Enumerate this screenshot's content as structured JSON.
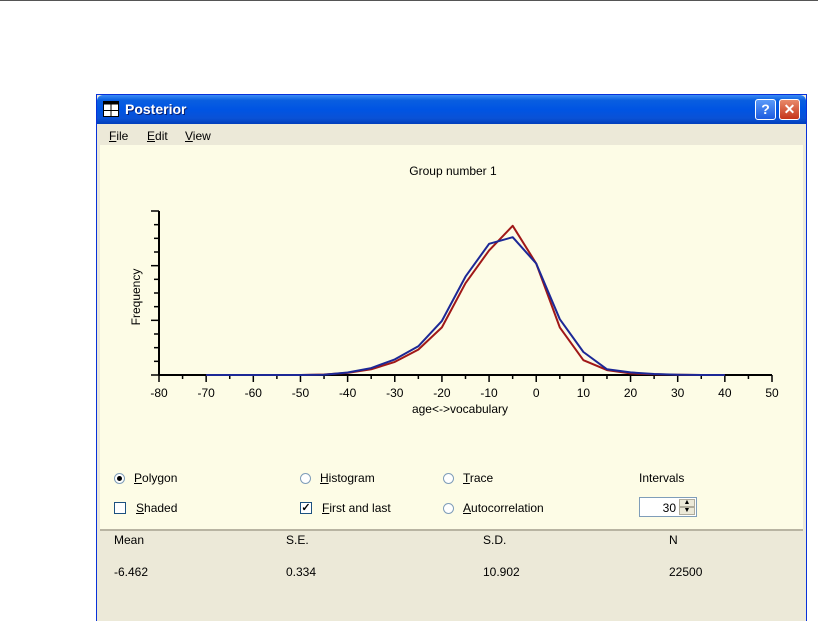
{
  "window": {
    "title": "Posterior"
  },
  "menu": [
    {
      "key": "F",
      "rest": "ile"
    },
    {
      "key": "E",
      "rest": "dit"
    },
    {
      "key": "V",
      "rest": "iew"
    }
  ],
  "chart_data": {
    "type": "line",
    "title": "Group number 1",
    "xlabel": "age<->vocabulary",
    "ylabel": "Frequency",
    "xlim": [
      -80,
      50
    ],
    "xticks": [
      "-80",
      "-70",
      "-60",
      "-50",
      "-40",
      "-30",
      "-20",
      "-10",
      "0",
      "10",
      "20",
      "30",
      "40",
      "50"
    ],
    "series": [
      {
        "color": "#a01818",
        "x": [
          -70,
          -65,
          -60,
          -55,
          -50,
          -45,
          -40,
          -35,
          -30,
          -25,
          -20,
          -15,
          -10,
          -5,
          0,
          5,
          10,
          15,
          20,
          25,
          30,
          35,
          40
        ],
        "y": [
          0,
          0,
          0,
          0,
          0,
          0.3,
          1.3,
          3.5,
          8,
          15.5,
          29,
          56,
          76,
          91,
          68,
          29,
          9,
          3,
          1,
          0.4,
          0.2,
          0,
          0
        ]
      },
      {
        "color": "#1c2896",
        "x": [
          -70,
          -65,
          -60,
          -55,
          -50,
          -45,
          -40,
          -35,
          -30,
          -25,
          -20,
          -15,
          -10,
          -5,
          0,
          5,
          10,
          15,
          20,
          25,
          30,
          35,
          40
        ],
        "y": [
          0,
          0,
          0,
          0,
          0,
          0.2,
          1.5,
          4.2,
          9.5,
          17.5,
          33,
          60,
          80,
          84,
          68,
          34,
          14,
          3.5,
          1.6,
          0.6,
          0.2,
          0,
          0
        ]
      }
    ]
  },
  "controls": {
    "polygon": "olygon",
    "polygon_key": "P",
    "histogram": "istogram",
    "histogram_key": "H",
    "trace": "race",
    "trace_key": "T",
    "intervals_label": "Intervals",
    "shaded": "haded",
    "shaded_key": "S",
    "first_last": "irst and last",
    "first_last_key": "F",
    "autocorr": "utocorrelation",
    "autocorr_key": "A",
    "intervals_value": "30",
    "selected": "polygon",
    "first_last_checked": true,
    "shaded_checked": false
  },
  "stats": {
    "headers": [
      "Mean",
      "S.E.",
      "S.D.",
      "N"
    ],
    "values": [
      "-6.462",
      "0.334",
      "10.902",
      "22500"
    ]
  }
}
